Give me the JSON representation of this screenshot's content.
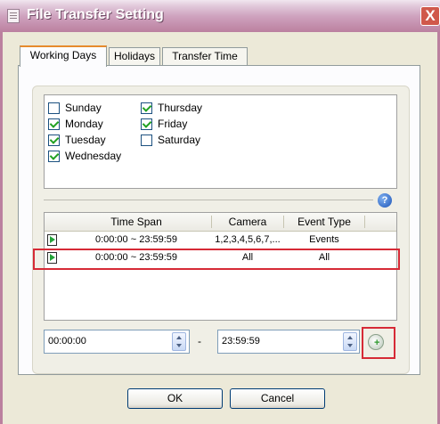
{
  "window": {
    "title": "File Transfer Setting",
    "close_label": "X"
  },
  "tabs": [
    {
      "label": "Working Days",
      "active": true
    },
    {
      "label": "Holidays",
      "active": false
    },
    {
      "label": "Transfer Time",
      "active": false
    }
  ],
  "days": [
    {
      "label": "Sunday",
      "checked": false
    },
    {
      "label": "Monday",
      "checked": true
    },
    {
      "label": "Tuesday",
      "checked": true
    },
    {
      "label": "Wednesday",
      "checked": true
    },
    {
      "label": "Thursday",
      "checked": true
    },
    {
      "label": "Friday",
      "checked": true
    },
    {
      "label": "Saturday",
      "checked": false
    }
  ],
  "help_icon": "question-icon",
  "table": {
    "headers": [
      "Time Span",
      "Camera",
      "Event Type"
    ],
    "rows": [
      {
        "time_span": "0:00:00 ~ 23:59:59",
        "camera": "1,2,3,4,5,6,7,...",
        "event_type": "Events"
      },
      {
        "time_span": "0:00:00 ~ 23:59:59",
        "camera": "All",
        "event_type": "All"
      }
    ]
  },
  "time_range": {
    "start": "00:00:00",
    "separator": "-",
    "end": "23:59:59"
  },
  "buttons": {
    "ok": "OK",
    "cancel": "Cancel"
  },
  "colors": {
    "titlebar": "#bb809f",
    "highlight": "#d62a36",
    "check": "#21a121"
  }
}
